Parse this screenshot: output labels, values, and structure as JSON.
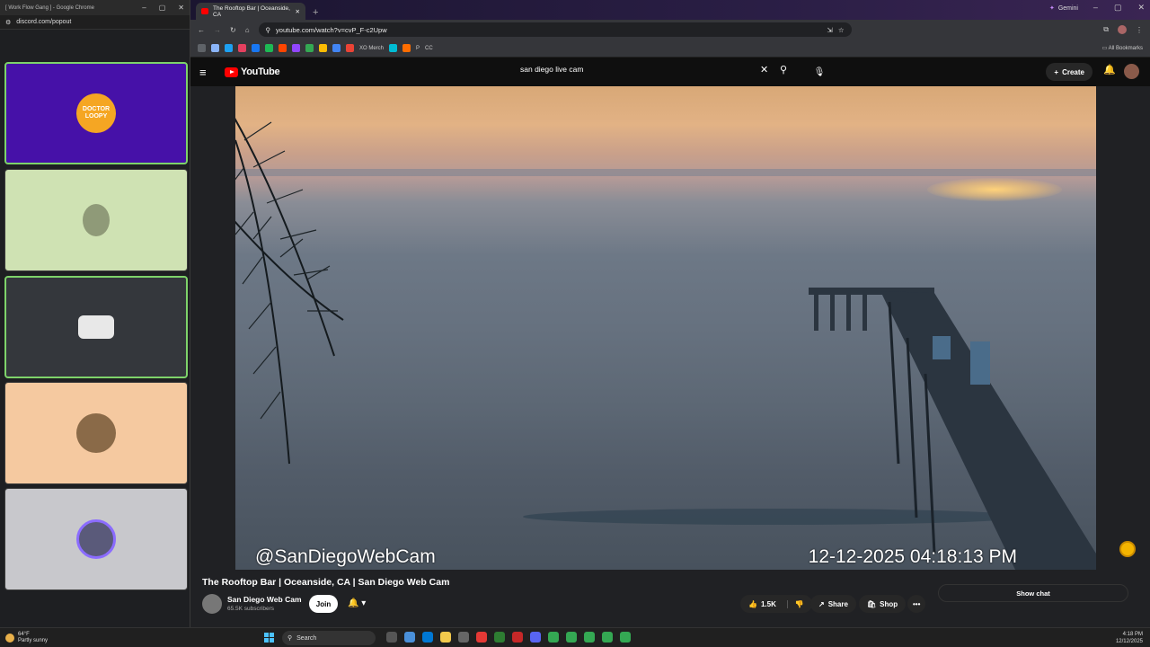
{
  "discord": {
    "window_title": "[ Work Flow Gang ] - Google Chrome",
    "url": "discord.com/popout",
    "tiles": [
      {
        "label": "DOCTOR LOOPY",
        "bg": "#4611a8"
      },
      {
        "label": "",
        "bg": "#cfe2b3"
      },
      {
        "label": "",
        "bg": "#34373c"
      },
      {
        "label": "",
        "bg": "#f5c9a0"
      },
      {
        "label": "",
        "bg": "#c8c8cc"
      }
    ]
  },
  "browser": {
    "tab_title": "The Rooftop Bar | Oceanside, CA",
    "url": "youtube.com/watch?v=cvP_F-c2Upw",
    "gemini_label": "Gemini",
    "bookmarks_label": "All Bookmarks",
    "bookmark_text": [
      "XO Merch",
      "P",
      "CC"
    ]
  },
  "youtube": {
    "logo": "YouTube",
    "search_query": "san diego live cam",
    "create_label": "Create",
    "video": {
      "watermark": "@SanDiegoWebCam",
      "timestamp": "12-12-2025 04:18:13 PM"
    },
    "title": "The Rooftop Bar | Oceanside, CA | San Diego Web Cam",
    "channel": {
      "name": "San Diego Web Cam",
      "subscribers": "65.5K subscribers"
    },
    "join_label": "Join",
    "likes": "1.5K",
    "share_label": "Share",
    "shop_label": "Shop",
    "more_label": "•••",
    "show_chat_label": "Show chat"
  },
  "taskbar": {
    "temp": "64°F",
    "weather": "Partly sunny",
    "search_label": "Search",
    "time": "4:18 PM",
    "date": "12/12/2025"
  }
}
